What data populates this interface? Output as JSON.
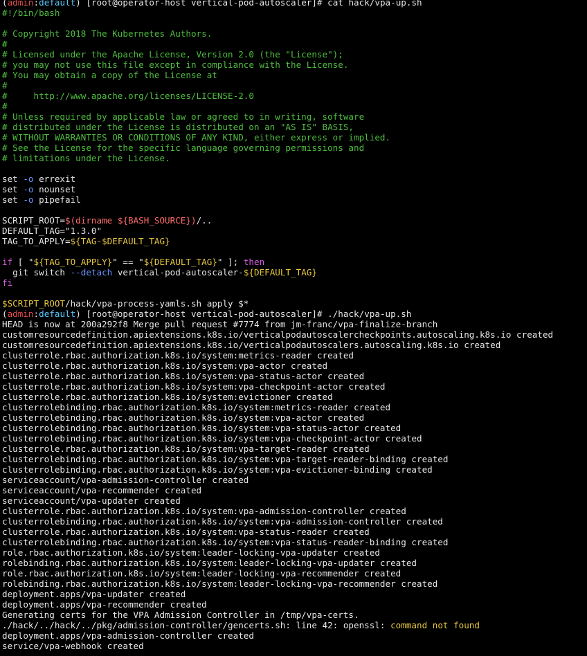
{
  "terminal": {
    "colors": {
      "background": "#000000",
      "text": "#e6e6e6",
      "comment": "#4fbe3f",
      "admin": "#e44d4d",
      "context": "#5cc8ff",
      "variable": "#ff6b6b",
      "string": "#e6e6e6",
      "keyword": "#d85ce0",
      "option": "#6f96ff",
      "warning": "#e5c63e"
    },
    "lines": [
      {
        "segs": [
          {
            "t": "(",
            "c": "text"
          },
          {
            "t": "admin",
            "c": "admin"
          },
          {
            "t": ":",
            "c": "text"
          },
          {
            "t": "default",
            "c": "context"
          },
          {
            "t": ") [root@operator-host vertical-pod-autoscaler]# cat hack/vpa-up.sh",
            "c": "text"
          }
        ]
      },
      {
        "segs": [
          {
            "t": "#!/bin/bash",
            "c": "comment"
          }
        ]
      },
      {
        "segs": []
      },
      {
        "segs": [
          {
            "t": "# Copyright 2018 The Kubernetes Authors.",
            "c": "comment"
          }
        ]
      },
      {
        "segs": [
          {
            "t": "#",
            "c": "comment"
          }
        ]
      },
      {
        "segs": [
          {
            "t": "# Licensed under the Apache License, Version 2.0 (the \"License\");",
            "c": "comment"
          }
        ]
      },
      {
        "segs": [
          {
            "t": "# you may not use this file except in compliance with the License.",
            "c": "comment"
          }
        ]
      },
      {
        "segs": [
          {
            "t": "# You may obtain a copy of the License at",
            "c": "comment"
          }
        ]
      },
      {
        "segs": [
          {
            "t": "#",
            "c": "comment"
          }
        ]
      },
      {
        "segs": [
          {
            "t": "#     http://www.apache.org/licenses/LICENSE-2.0",
            "c": "comment"
          }
        ]
      },
      {
        "segs": [
          {
            "t": "#",
            "c": "comment"
          }
        ]
      },
      {
        "segs": [
          {
            "t": "# Unless required by applicable law or agreed to in writing, software",
            "c": "comment"
          }
        ]
      },
      {
        "segs": [
          {
            "t": "# distributed under the License is distributed on an \"AS IS\" BASIS,",
            "c": "comment"
          }
        ]
      },
      {
        "segs": [
          {
            "t": "# WITHOUT WARRANTIES OR CONDITIONS OF ANY KIND, either express or implied.",
            "c": "comment"
          }
        ]
      },
      {
        "segs": [
          {
            "t": "# See the License for the specific language governing permissions and",
            "c": "comment"
          }
        ]
      },
      {
        "segs": [
          {
            "t": "# limitations under the License.",
            "c": "comment"
          }
        ]
      },
      {
        "segs": []
      },
      {
        "segs": [
          {
            "t": "set ",
            "c": "text"
          },
          {
            "t": "-o",
            "c": "option"
          },
          {
            "t": " errexit",
            "c": "text"
          }
        ]
      },
      {
        "segs": [
          {
            "t": "set ",
            "c": "text"
          },
          {
            "t": "-o",
            "c": "option"
          },
          {
            "t": " nounset",
            "c": "text"
          }
        ]
      },
      {
        "segs": [
          {
            "t": "set ",
            "c": "text"
          },
          {
            "t": "-o",
            "c": "option"
          },
          {
            "t": " pipefail",
            "c": "text"
          }
        ]
      },
      {
        "segs": []
      },
      {
        "segs": [
          {
            "t": "SCRIPT_ROOT=",
            "c": "text"
          },
          {
            "t": "$(dirname ${BASH_SOURCE})",
            "c": "variable"
          },
          {
            "t": "/..",
            "c": "text"
          }
        ]
      },
      {
        "segs": [
          {
            "t": "DEFAULT_TAG=\"1.3.0\"",
            "c": "text"
          }
        ]
      },
      {
        "segs": [
          {
            "t": "TAG_TO_APPLY=",
            "c": "text"
          },
          {
            "t": "${TAG-$DEFAULT_TAG}",
            "c": "warning"
          }
        ]
      },
      {
        "segs": []
      },
      {
        "segs": [
          {
            "t": "if",
            "c": "keyword"
          },
          {
            "t": " [ \"",
            "c": "text"
          },
          {
            "t": "${TAG_TO_APPLY}",
            "c": "warning"
          },
          {
            "t": "\" == \"",
            "c": "text"
          },
          {
            "t": "${DEFAULT_TAG}",
            "c": "warning"
          },
          {
            "t": "\" ]; ",
            "c": "text"
          },
          {
            "t": "then",
            "c": "keyword"
          }
        ]
      },
      {
        "segs": [
          {
            "t": "  git switch ",
            "c": "text"
          },
          {
            "t": "--detach",
            "c": "option"
          },
          {
            "t": " vertical-pod-autoscaler-",
            "c": "text"
          },
          {
            "t": "${DEFAULT_TAG}",
            "c": "warning"
          }
        ]
      },
      {
        "segs": [
          {
            "t": "fi",
            "c": "keyword"
          }
        ]
      },
      {
        "segs": []
      },
      {
        "segs": [
          {
            "t": "$SCRIPT_ROOT",
            "c": "warning"
          },
          {
            "t": "/hack/vpa-process-yamls.sh apply $*",
            "c": "text"
          }
        ]
      },
      {
        "segs": [
          {
            "t": "(",
            "c": "text"
          },
          {
            "t": "admin",
            "c": "admin"
          },
          {
            "t": ":",
            "c": "text"
          },
          {
            "t": "default",
            "c": "context"
          },
          {
            "t": ") [root@operator-host vertical-pod-autoscaler]# ./hack/vpa-up.sh",
            "c": "text"
          }
        ]
      },
      {
        "segs": [
          {
            "t": "HEAD is now at 200a292f8 Merge pull request #7774 from jm-franc/vpa-finalize-branch",
            "c": "text"
          }
        ]
      },
      {
        "segs": [
          {
            "t": "customresourcedefinition.apiextensions.k8s.io/verticalpodautoscalercheckpoints.autoscaling.k8s.io created",
            "c": "text"
          }
        ]
      },
      {
        "segs": [
          {
            "t": "customresourcedefinition.apiextensions.k8s.io/verticalpodautoscalers.autoscaling.k8s.io created",
            "c": "text"
          }
        ]
      },
      {
        "segs": [
          {
            "t": "clusterrole.rbac.authorization.k8s.io/system:metrics-reader created",
            "c": "text"
          }
        ]
      },
      {
        "segs": [
          {
            "t": "clusterrole.rbac.authorization.k8s.io/system:vpa-actor created",
            "c": "text"
          }
        ]
      },
      {
        "segs": [
          {
            "t": "clusterrole.rbac.authorization.k8s.io/system:vpa-status-actor created",
            "c": "text"
          }
        ]
      },
      {
        "segs": [
          {
            "t": "clusterrole.rbac.authorization.k8s.io/system:vpa-checkpoint-actor created",
            "c": "text"
          }
        ]
      },
      {
        "segs": [
          {
            "t": "clusterrole.rbac.authorization.k8s.io/system:evictioner created",
            "c": "text"
          }
        ]
      },
      {
        "segs": [
          {
            "t": "clusterrolebinding.rbac.authorization.k8s.io/system:metrics-reader created",
            "c": "text"
          }
        ]
      },
      {
        "segs": [
          {
            "t": "clusterrolebinding.rbac.authorization.k8s.io/system:vpa-actor created",
            "c": "text"
          }
        ]
      },
      {
        "segs": [
          {
            "t": "clusterrolebinding.rbac.authorization.k8s.io/system:vpa-status-actor created",
            "c": "text"
          }
        ]
      },
      {
        "segs": [
          {
            "t": "clusterrolebinding.rbac.authorization.k8s.io/system:vpa-checkpoint-actor created",
            "c": "text"
          }
        ]
      },
      {
        "segs": [
          {
            "t": "clusterrole.rbac.authorization.k8s.io/system:vpa-target-reader created",
            "c": "text"
          }
        ]
      },
      {
        "segs": [
          {
            "t": "clusterrolebinding.rbac.authorization.k8s.io/system:vpa-target-reader-binding created",
            "c": "text"
          }
        ]
      },
      {
        "segs": [
          {
            "t": "clusterrolebinding.rbac.authorization.k8s.io/system:vpa-evictioner-binding created",
            "c": "text"
          }
        ]
      },
      {
        "segs": [
          {
            "t": "serviceaccount/vpa-admission-controller created",
            "c": "text"
          }
        ]
      },
      {
        "segs": [
          {
            "t": "serviceaccount/vpa-recommender created",
            "c": "text"
          }
        ]
      },
      {
        "segs": [
          {
            "t": "serviceaccount/vpa-updater created",
            "c": "text"
          }
        ]
      },
      {
        "segs": [
          {
            "t": "clusterrole.rbac.authorization.k8s.io/system:vpa-admission-controller created",
            "c": "text"
          }
        ]
      },
      {
        "segs": [
          {
            "t": "clusterrolebinding.rbac.authorization.k8s.io/system:vpa-admission-controller created",
            "c": "text"
          }
        ]
      },
      {
        "segs": [
          {
            "t": "clusterrole.rbac.authorization.k8s.io/system:vpa-status-reader created",
            "c": "text"
          }
        ]
      },
      {
        "segs": [
          {
            "t": "clusterrolebinding.rbac.authorization.k8s.io/system:vpa-status-reader-binding created",
            "c": "text"
          }
        ]
      },
      {
        "segs": [
          {
            "t": "role.rbac.authorization.k8s.io/system:leader-locking-vpa-updater created",
            "c": "text"
          }
        ]
      },
      {
        "segs": [
          {
            "t": "rolebinding.rbac.authorization.k8s.io/system:leader-locking-vpa-updater created",
            "c": "text"
          }
        ]
      },
      {
        "segs": [
          {
            "t": "role.rbac.authorization.k8s.io/system:leader-locking-vpa-recommender created",
            "c": "text"
          }
        ]
      },
      {
        "segs": [
          {
            "t": "rolebinding.rbac.authorization.k8s.io/system:leader-locking-vpa-recommender created",
            "c": "text"
          }
        ]
      },
      {
        "segs": [
          {
            "t": "deployment.apps/vpa-updater created",
            "c": "text"
          }
        ]
      },
      {
        "segs": [
          {
            "t": "deployment.apps/vpa-recommender created",
            "c": "text"
          }
        ]
      },
      {
        "segs": [
          {
            "t": "Generating certs for the VPA Admission Controller in /tmp/vpa-certs.",
            "c": "text"
          }
        ]
      },
      {
        "segs": [
          {
            "t": "./hack/../hack/../pkg/admission-controller/gencerts.sh: line 42: openssl: ",
            "c": "text"
          },
          {
            "t": "command not found",
            "c": "warning"
          }
        ]
      },
      {
        "segs": [
          {
            "t": "deployment.apps/vpa-admission-controller created",
            "c": "text"
          }
        ]
      },
      {
        "segs": [
          {
            "t": "service/vpa-webhook created",
            "c": "text"
          }
        ]
      }
    ]
  }
}
